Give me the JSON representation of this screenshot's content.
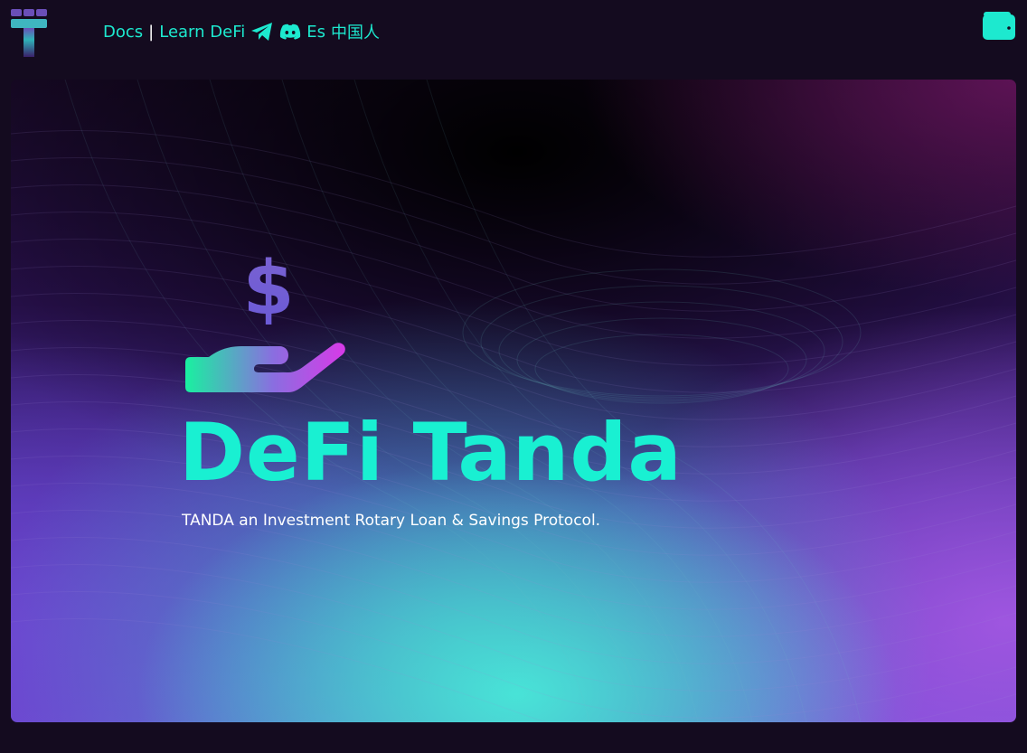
{
  "header": {
    "logo_icon": "tanda-logo-icon",
    "nav": {
      "docs_label": "Docs",
      "separator": "|",
      "learn_label": "Learn DeFi",
      "telegram_icon": "telegram-icon",
      "discord_icon": "discord-icon",
      "lang_es_label": "Es",
      "lang_zh_label": "中国人"
    },
    "wallet_icon": "wallet-icon"
  },
  "hero": {
    "icon": "hand-dollar-icon",
    "title": "DeFi Tanda",
    "subtitle": "TANDA an Investment Rotary Loan & Savings Protocol."
  },
  "colors": {
    "accent": "#1de9cf",
    "background": "#140b1f",
    "hero_title": "#19f0d2",
    "gradient_purple": "#6b4ad0",
    "gradient_magenta": "#d639e8"
  }
}
